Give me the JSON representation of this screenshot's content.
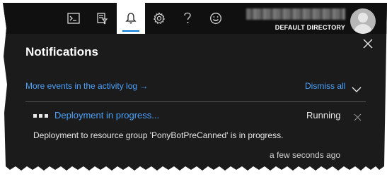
{
  "topbar": {
    "buttons": [
      {
        "icon": "cloud-shell-icon",
        "active": false
      },
      {
        "icon": "directory-filter-icon",
        "active": false
      },
      {
        "icon": "bell-icon",
        "active": true
      },
      {
        "icon": "gear-icon",
        "active": false
      },
      {
        "icon": "help-icon",
        "active": false
      },
      {
        "icon": "smiley-feedback-icon",
        "active": false
      }
    ],
    "account": {
      "directory": "DEFAULT DIRECTORY",
      "name_blurred": true
    }
  },
  "panel": {
    "title": "Notifications",
    "activity_link": "More events in the activity log →",
    "dismiss_all": "Dismiss all",
    "notification": {
      "title": "Deployment in progress...",
      "status": "Running",
      "body": "Deployment to resource group 'PonyBotPreCanned' is in progress.",
      "time": "a few seconds ago"
    }
  },
  "colors": {
    "panel_bg": "#1b1b1b",
    "topbar_bg": "#101010",
    "link": "#4aa2ff",
    "active_tab_bg": "#ffffff",
    "active_indicator": "#0078d4"
  }
}
